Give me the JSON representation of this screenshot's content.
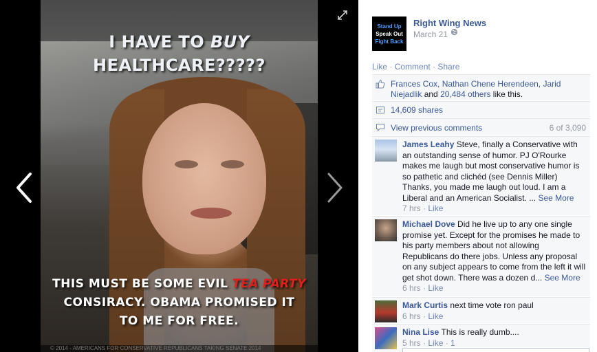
{
  "viewer": {
    "caption_top_line1": "I HAVE TO ",
    "caption_top_buy": "BUY",
    "caption_top_line2": "HEALTHCARE?????",
    "caption_bottom_line1_a": "THIS MUST BE SOME EVIL ",
    "caption_bottom_line1_b": "TEA PARTY",
    "caption_bottom_line2": "CONSIRACY.  OBAMA PROMISED IT",
    "caption_bottom_line3": "TO ME FOR FREE.",
    "watermark": "© 2014 - AMERICANS FOR CONSERVATIVE REPUBLICANS TAKING SENATE 2014",
    "highlight_color": "#e0201c"
  },
  "post": {
    "page_avatar": [
      "Stand Up",
      "Speak Out",
      "Fight Back"
    ],
    "page_name": "Right Wing News",
    "date": "March 21",
    "actions": {
      "like": "Like",
      "comment": "Comment",
      "share": "Share",
      "sep": " · "
    },
    "likes": {
      "names_a": "Frances Cox, Nathan Chene Herendeen, Jarid Niejadlik",
      "and": " and ",
      "others": "20,484 others",
      "suffix": " like this."
    },
    "shares": "14,609 shares",
    "view_previous": "View previous comments",
    "comment_count": "6 of 3,090"
  },
  "comments": [
    {
      "author": "James Leahy",
      "text": "Steve, finally a Conservative with an outstanding sense of humor. PJ O'Rourke makes me laugh but most conservative humor is so pathetic and clichéd (see Dennis Miller) Thanks, you made me laugh out loud. I am a Liberal and an American Socialist. ...",
      "see_more": "See More",
      "time": "7 hrs",
      "like": "Like"
    },
    {
      "author": "Michael Dove",
      "text": "Did he live up to any one single promise yet. Except for the promises he made to his party members about not allowing Republicans do there jobs. Unless any proposal on any subject appears to come from the left it will get shot down. There was a dozen d...",
      "see_more": "See More",
      "time": "6 hrs",
      "like": "Like"
    },
    {
      "author": "Mark Curtis",
      "text": "next time vote ron paul",
      "time": "6 hrs",
      "like": "Like"
    },
    {
      "author": "Nina Lise",
      "text": "This is really dumb....",
      "time": "5 hrs",
      "like": "Like",
      "likes_count": "1"
    }
  ]
}
